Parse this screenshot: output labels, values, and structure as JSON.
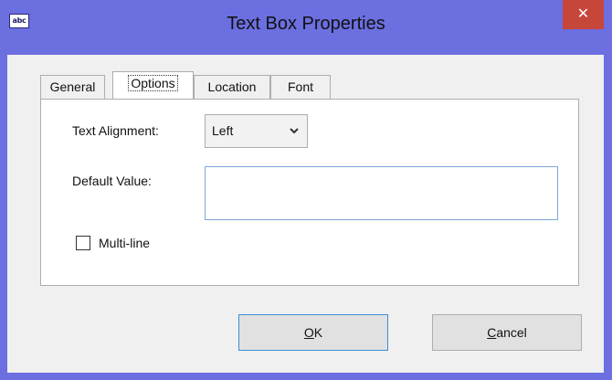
{
  "window": {
    "icon_text": "abc",
    "title": "Text Box Properties",
    "close_glyph": "✕"
  },
  "tabs": [
    {
      "label": "General",
      "selected": false
    },
    {
      "label": "Options",
      "selected": true
    },
    {
      "label": "Location",
      "selected": false
    },
    {
      "label": "Font",
      "selected": false
    }
  ],
  "options": {
    "text_alignment_label": "Text Alignment:",
    "text_alignment_value": "Left",
    "default_value_label": "Default Value:",
    "default_value": "",
    "multiline_label": "Multi-line",
    "multiline_checked": false
  },
  "buttons": {
    "ok_mnemonic": "O",
    "ok_rest": "K",
    "cancel_mnemonic": "C",
    "cancel_rest": "ancel"
  },
  "icons": {
    "dropdown": "chevron-down-icon",
    "close": "close-icon",
    "app": "text-box-icon"
  },
  "colors": {
    "frame": "#6b6fe0",
    "close": "#c7463a",
    "focus_border": "#3c8fd8"
  }
}
